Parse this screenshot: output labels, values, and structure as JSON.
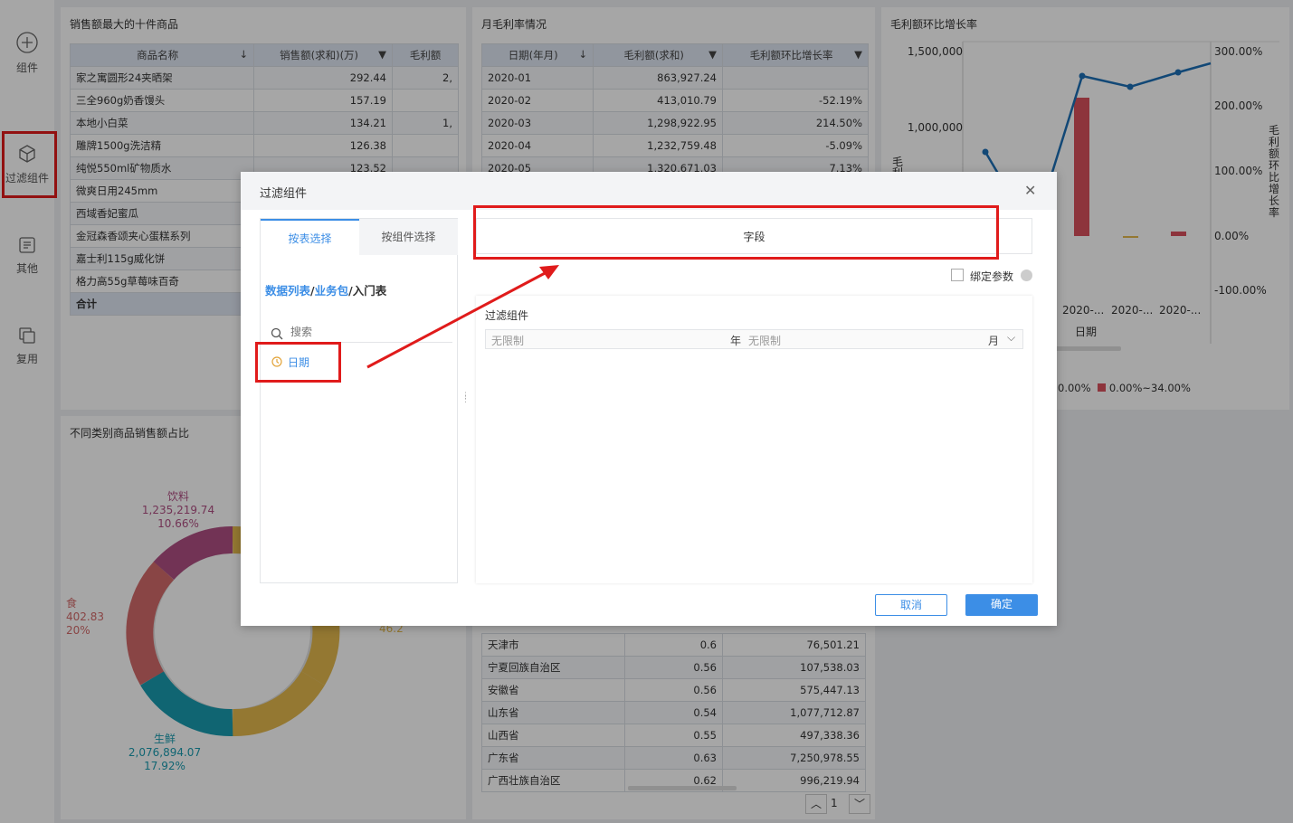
{
  "sidebar": {
    "items": [
      {
        "label": "组件",
        "icon": "plus-circle-icon"
      },
      {
        "label": "过滤组件",
        "icon": "cube-icon"
      },
      {
        "label": "其他",
        "icon": "document-icon"
      },
      {
        "label": "复用",
        "icon": "copy-icon"
      }
    ]
  },
  "top_products": {
    "title": "销售额最大的十件商品",
    "headers": [
      "商品名称",
      "销售额(求和)(万)",
      "毛利额"
    ],
    "rows": [
      {
        "name": "家之寓圆形24夹晒架",
        "sales": "292.44",
        "margin": "2,"
      },
      {
        "name": "三全960g奶香馒头",
        "sales": "157.19",
        "margin": ""
      },
      {
        "name": "本地小白菜",
        "sales": "134.21",
        "margin": "1,"
      },
      {
        "name": "雕牌1500g洗洁精",
        "sales": "126.38",
        "margin": ""
      },
      {
        "name": "纯悦550ml矿物质水",
        "sales": "123.52",
        "margin": ""
      },
      {
        "name": "微爽日用245mm",
        "sales": "",
        "margin": ""
      },
      {
        "name": "西域香妃蜜瓜",
        "sales": "",
        "margin": ""
      },
      {
        "name": "金冠森香颂夹心蛋糕系列",
        "sales": "",
        "margin": ""
      },
      {
        "name": "嘉士利115g威化饼",
        "sales": "",
        "margin": ""
      },
      {
        "name": "格力高55g草莓味百奇",
        "sales": "",
        "margin": ""
      }
    ],
    "total_label": "合计"
  },
  "monthly_margin": {
    "title": "月毛利率情况",
    "headers": [
      "日期(年月)",
      "毛利额(求和)",
      "毛利额环比增长率"
    ],
    "rows": [
      {
        "date": "2020-01",
        "margin": "863,927.24",
        "rate": ""
      },
      {
        "date": "2020-02",
        "margin": "413,010.79",
        "rate": "-52.19%"
      },
      {
        "date": "2020-03",
        "margin": "1,298,922.95",
        "rate": "214.50%"
      },
      {
        "date": "2020-04",
        "margin": "1,232,759.48",
        "rate": "-5.09%"
      },
      {
        "date": "2020-05",
        "margin": "1,320,671.03",
        "rate": "7.13%"
      }
    ]
  },
  "growth_chart": {
    "title": "毛利额环比增长率",
    "y_left_ticks": [
      "1,500,000",
      "1,000,000"
    ],
    "y_left_label": "毛利",
    "y_right_ticks": [
      "300.00%",
      "200.00%",
      "100.00%",
      "0.00%",
      "-100.00%"
    ],
    "y_right_label": "毛利额环比增长率",
    "x_ticks": [
      "2020-...",
      "2020-...",
      "2020-..."
    ],
    "x_label": "日期",
    "legend": [
      {
        "label": "0.00%",
        "color": "#4a8bd6"
      },
      {
        "label": "0.00%~34.00%",
        "color": "#d9515c"
      }
    ]
  },
  "donut": {
    "title": "不同类别商品销售额占比",
    "labels": [
      {
        "name": "饮料",
        "value": "1,235,219.74",
        "pct": "10.66%",
        "color": "#b04f83"
      },
      {
        "name": "食",
        "value": "402.83",
        "pct": "20%",
        "color": "#d36b6b"
      },
      {
        "name": "生鲜",
        "value": "2,076,894.07",
        "pct": "17.92%",
        "color": "#1a9cb0"
      },
      {
        "name": "",
        "value": "46.2",
        "pct": "",
        "color": "#e3b94e"
      }
    ]
  },
  "province_table": {
    "rows": [
      {
        "name": "天津市",
        "ratio": "0.6",
        "value": "76,501.21"
      },
      {
        "name": "宁夏回族自治区",
        "ratio": "0.56",
        "value": "107,538.03"
      },
      {
        "name": "安徽省",
        "ratio": "0.56",
        "value": "575,447.13"
      },
      {
        "name": "山东省",
        "ratio": "0.54",
        "value": "1,077,712.87"
      },
      {
        "name": "山西省",
        "ratio": "0.55",
        "value": "497,338.36"
      },
      {
        "name": "广东省",
        "ratio": "0.63",
        "value": "7,250,978.55"
      },
      {
        "name": "广西壮族自治区",
        "ratio": "0.62",
        "value": "996,219.94"
      }
    ],
    "page": "1"
  },
  "dialog": {
    "title": "过滤组件",
    "tabs": [
      "按表选择",
      "按组件选择"
    ],
    "breadcrumb": {
      "a": "数据列表",
      "sep1": "/",
      "b": "业务包",
      "sep2": "/",
      "c": "入门表"
    },
    "search_placeholder": "搜索",
    "field_item": "日期",
    "field_zone_label": "字段",
    "bind_param_label": "绑定参数",
    "preview_title": "过滤组件",
    "year_placeholder": "无限制",
    "year_unit": "年",
    "month_placeholder": "无限制",
    "month_unit": "月",
    "cancel_label": "取消",
    "confirm_label": "确定"
  },
  "colors": {
    "accent": "#3c8ee6",
    "highlight": "#e01b1b"
  }
}
